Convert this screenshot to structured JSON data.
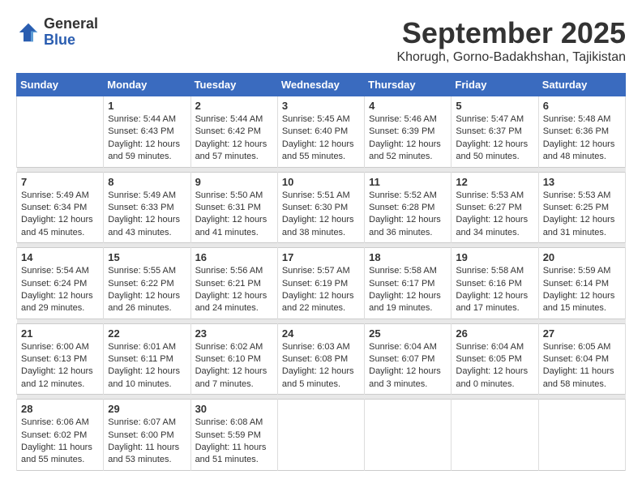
{
  "header": {
    "logo_line1": "General",
    "logo_line2": "Blue",
    "month_year": "September 2025",
    "location": "Khorugh, Gorno-Badakhshan, Tajikistan"
  },
  "weekdays": [
    "Sunday",
    "Monday",
    "Tuesday",
    "Wednesday",
    "Thursday",
    "Friday",
    "Saturday"
  ],
  "weeks": [
    [
      {
        "day": "",
        "sunrise": "",
        "sunset": "",
        "daylight": ""
      },
      {
        "day": "1",
        "sunrise": "Sunrise: 5:44 AM",
        "sunset": "Sunset: 6:43 PM",
        "daylight": "Daylight: 12 hours and 59 minutes."
      },
      {
        "day": "2",
        "sunrise": "Sunrise: 5:44 AM",
        "sunset": "Sunset: 6:42 PM",
        "daylight": "Daylight: 12 hours and 57 minutes."
      },
      {
        "day": "3",
        "sunrise": "Sunrise: 5:45 AM",
        "sunset": "Sunset: 6:40 PM",
        "daylight": "Daylight: 12 hours and 55 minutes."
      },
      {
        "day": "4",
        "sunrise": "Sunrise: 5:46 AM",
        "sunset": "Sunset: 6:39 PM",
        "daylight": "Daylight: 12 hours and 52 minutes."
      },
      {
        "day": "5",
        "sunrise": "Sunrise: 5:47 AM",
        "sunset": "Sunset: 6:37 PM",
        "daylight": "Daylight: 12 hours and 50 minutes."
      },
      {
        "day": "6",
        "sunrise": "Sunrise: 5:48 AM",
        "sunset": "Sunset: 6:36 PM",
        "daylight": "Daylight: 12 hours and 48 minutes."
      }
    ],
    [
      {
        "day": "7",
        "sunrise": "Sunrise: 5:49 AM",
        "sunset": "Sunset: 6:34 PM",
        "daylight": "Daylight: 12 hours and 45 minutes."
      },
      {
        "day": "8",
        "sunrise": "Sunrise: 5:49 AM",
        "sunset": "Sunset: 6:33 PM",
        "daylight": "Daylight: 12 hours and 43 minutes."
      },
      {
        "day": "9",
        "sunrise": "Sunrise: 5:50 AM",
        "sunset": "Sunset: 6:31 PM",
        "daylight": "Daylight: 12 hours and 41 minutes."
      },
      {
        "day": "10",
        "sunrise": "Sunrise: 5:51 AM",
        "sunset": "Sunset: 6:30 PM",
        "daylight": "Daylight: 12 hours and 38 minutes."
      },
      {
        "day": "11",
        "sunrise": "Sunrise: 5:52 AM",
        "sunset": "Sunset: 6:28 PM",
        "daylight": "Daylight: 12 hours and 36 minutes."
      },
      {
        "day": "12",
        "sunrise": "Sunrise: 5:53 AM",
        "sunset": "Sunset: 6:27 PM",
        "daylight": "Daylight: 12 hours and 34 minutes."
      },
      {
        "day": "13",
        "sunrise": "Sunrise: 5:53 AM",
        "sunset": "Sunset: 6:25 PM",
        "daylight": "Daylight: 12 hours and 31 minutes."
      }
    ],
    [
      {
        "day": "14",
        "sunrise": "Sunrise: 5:54 AM",
        "sunset": "Sunset: 6:24 PM",
        "daylight": "Daylight: 12 hours and 29 minutes."
      },
      {
        "day": "15",
        "sunrise": "Sunrise: 5:55 AM",
        "sunset": "Sunset: 6:22 PM",
        "daylight": "Daylight: 12 hours and 26 minutes."
      },
      {
        "day": "16",
        "sunrise": "Sunrise: 5:56 AM",
        "sunset": "Sunset: 6:21 PM",
        "daylight": "Daylight: 12 hours and 24 minutes."
      },
      {
        "day": "17",
        "sunrise": "Sunrise: 5:57 AM",
        "sunset": "Sunset: 6:19 PM",
        "daylight": "Daylight: 12 hours and 22 minutes."
      },
      {
        "day": "18",
        "sunrise": "Sunrise: 5:58 AM",
        "sunset": "Sunset: 6:17 PM",
        "daylight": "Daylight: 12 hours and 19 minutes."
      },
      {
        "day": "19",
        "sunrise": "Sunrise: 5:58 AM",
        "sunset": "Sunset: 6:16 PM",
        "daylight": "Daylight: 12 hours and 17 minutes."
      },
      {
        "day": "20",
        "sunrise": "Sunrise: 5:59 AM",
        "sunset": "Sunset: 6:14 PM",
        "daylight": "Daylight: 12 hours and 15 minutes."
      }
    ],
    [
      {
        "day": "21",
        "sunrise": "Sunrise: 6:00 AM",
        "sunset": "Sunset: 6:13 PM",
        "daylight": "Daylight: 12 hours and 12 minutes."
      },
      {
        "day": "22",
        "sunrise": "Sunrise: 6:01 AM",
        "sunset": "Sunset: 6:11 PM",
        "daylight": "Daylight: 12 hours and 10 minutes."
      },
      {
        "day": "23",
        "sunrise": "Sunrise: 6:02 AM",
        "sunset": "Sunset: 6:10 PM",
        "daylight": "Daylight: 12 hours and 7 minutes."
      },
      {
        "day": "24",
        "sunrise": "Sunrise: 6:03 AM",
        "sunset": "Sunset: 6:08 PM",
        "daylight": "Daylight: 12 hours and 5 minutes."
      },
      {
        "day": "25",
        "sunrise": "Sunrise: 6:04 AM",
        "sunset": "Sunset: 6:07 PM",
        "daylight": "Daylight: 12 hours and 3 minutes."
      },
      {
        "day": "26",
        "sunrise": "Sunrise: 6:04 AM",
        "sunset": "Sunset: 6:05 PM",
        "daylight": "Daylight: 12 hours and 0 minutes."
      },
      {
        "day": "27",
        "sunrise": "Sunrise: 6:05 AM",
        "sunset": "Sunset: 6:04 PM",
        "daylight": "Daylight: 11 hours and 58 minutes."
      }
    ],
    [
      {
        "day": "28",
        "sunrise": "Sunrise: 6:06 AM",
        "sunset": "Sunset: 6:02 PM",
        "daylight": "Daylight: 11 hours and 55 minutes."
      },
      {
        "day": "29",
        "sunrise": "Sunrise: 6:07 AM",
        "sunset": "Sunset: 6:00 PM",
        "daylight": "Daylight: 11 hours and 53 minutes."
      },
      {
        "day": "30",
        "sunrise": "Sunrise: 6:08 AM",
        "sunset": "Sunset: 5:59 PM",
        "daylight": "Daylight: 11 hours and 51 minutes."
      },
      {
        "day": "",
        "sunrise": "",
        "sunset": "",
        "daylight": ""
      },
      {
        "day": "",
        "sunrise": "",
        "sunset": "",
        "daylight": ""
      },
      {
        "day": "",
        "sunrise": "",
        "sunset": "",
        "daylight": ""
      },
      {
        "day": "",
        "sunrise": "",
        "sunset": "",
        "daylight": ""
      }
    ]
  ]
}
